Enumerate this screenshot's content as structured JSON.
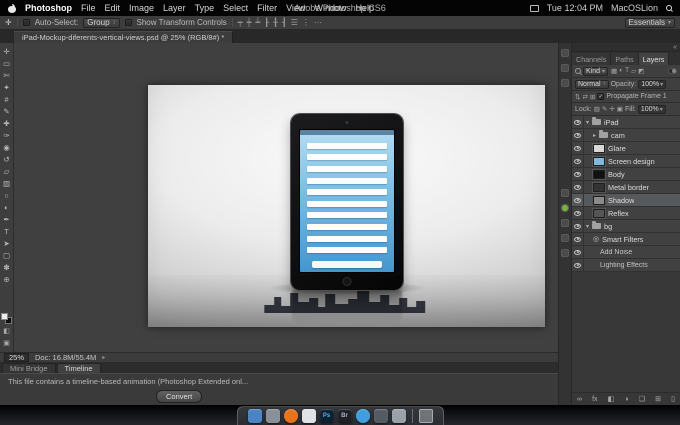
{
  "menubar": {
    "app_name": "Photoshop",
    "menus": [
      "File",
      "Edit",
      "Image",
      "Layer",
      "Type",
      "Select",
      "Filter",
      "View",
      "Window",
      "Help"
    ],
    "window_title": "Adobe Photoshop CS6",
    "time": "Tue 12:04 PM",
    "user": "MacOSLion"
  },
  "options_bar": {
    "tool_glyph": "✛",
    "auto_select_label": "Auto-Select:",
    "auto_select_value": "Group",
    "show_transform_label": "Show Transform Controls",
    "align_icons": [
      "┯",
      "┿",
      "┷",
      "┠",
      "╂",
      "┨",
      "☰",
      "⋮",
      "⋯"
    ],
    "workspace": "Essentials"
  },
  "ui_glyphs": {
    "popup": "↕",
    "dropdown": "▾",
    "collapse": "«",
    "status_arrow": "▸",
    "check": "✓"
  },
  "doc_tab": "iPad-Mockup-diferents-vertical-views.psd @ 25% (RGB/8#) *",
  "toolbar": {
    "tools": [
      {
        "name": "move-tool",
        "glyph": "✛"
      },
      {
        "name": "rectangular-marquee-tool",
        "glyph": "▭"
      },
      {
        "name": "lasso-tool",
        "glyph": "✄"
      },
      {
        "name": "quick-selection-tool",
        "glyph": "✦"
      },
      {
        "name": "crop-tool",
        "glyph": "#"
      },
      {
        "name": "eyedropper-tool",
        "glyph": "✎"
      },
      {
        "name": "healing-brush-tool",
        "glyph": "✚"
      },
      {
        "name": "brush-tool",
        "glyph": "✑"
      },
      {
        "name": "clone-stamp-tool",
        "glyph": "◉"
      },
      {
        "name": "history-brush-tool",
        "glyph": "↺"
      },
      {
        "name": "eraser-tool",
        "glyph": "▱"
      },
      {
        "name": "gradient-tool",
        "glyph": "▨"
      },
      {
        "name": "blur-tool",
        "glyph": "○"
      },
      {
        "name": "dodge-tool",
        "glyph": "◐"
      },
      {
        "name": "pen-tool",
        "glyph": "✒"
      },
      {
        "name": "type-tool",
        "glyph": "T"
      },
      {
        "name": "path-selection-tool",
        "glyph": "➤"
      },
      {
        "name": "shape-tool",
        "glyph": "▢"
      },
      {
        "name": "hand-tool",
        "glyph": "✽"
      },
      {
        "name": "zoom-tool",
        "glyph": "⊕"
      }
    ],
    "quick_mask_glyph": "◧",
    "screen_mode_glyph": "▣"
  },
  "panel_strip": {
    "icons": [
      {
        "name": "panel-icon-1",
        "color": "#4b4b4b"
      },
      {
        "name": "panel-icon-2",
        "color": "#4b4b4b"
      },
      {
        "name": "panel-icon-3",
        "color": "#4b4b4b"
      },
      {
        "name": "panel-icon-4",
        "color": "#4b4b4b",
        "gap_before": 95
      },
      {
        "name": "panel-icon-record",
        "color": "#77b43c",
        "shape": "circle"
      },
      {
        "name": "panel-icon-5",
        "color": "#4b4b4b"
      },
      {
        "name": "panel-icon-6",
        "color": "#4b4b4b"
      },
      {
        "name": "panel-icon-7",
        "color": "#4b4b4b"
      }
    ]
  },
  "layers_panel": {
    "tabs": [
      {
        "label": "Channels"
      },
      {
        "label": "Paths"
      },
      {
        "label": "Layers",
        "active": true
      }
    ],
    "filter": {
      "kind_label": "Kind",
      "type_icons": [
        {
          "name": "filter-pixel-layers-icon",
          "glyph": "▦"
        },
        {
          "name": "filter-adjustment-layers-icon",
          "glyph": "◐"
        },
        {
          "name": "filter-type-layers-icon",
          "glyph": "T"
        },
        {
          "name": "filter-shape-layers-icon",
          "glyph": "▱"
        },
        {
          "name": "filter-smart-objects-icon",
          "glyph": "◩"
        }
      ]
    },
    "blend": {
      "mode": "Normal",
      "opacity_label": "Opacity:",
      "opacity_value": "100%"
    },
    "unify": {
      "icons": [
        {
          "name": "unify-position-icon",
          "glyph": "⇅"
        },
        {
          "name": "unify-visibility-icon",
          "glyph": "⇄"
        },
        {
          "name": "unify-style-icon",
          "glyph": "⊞"
        }
      ],
      "propagate_label": "Propagate Frame 1"
    },
    "lock": {
      "label": "Lock:",
      "icons": [
        {
          "name": "lock-transparency-icon",
          "glyph": "▨"
        },
        {
          "name": "lock-image-icon",
          "glyph": "✎"
        },
        {
          "name": "lock-position-icon",
          "glyph": "✛"
        },
        {
          "name": "lock-all-icon",
          "glyph": "▣"
        }
      ],
      "fill_label": "Fill:",
      "fill_value": "100%"
    },
    "layers": [
      {
        "name": "iPad",
        "kind": "group",
        "depth": 0,
        "expanded": true
      },
      {
        "name": "cam",
        "kind": "group",
        "depth": 1
      },
      {
        "name": "Glare",
        "kind": "layer",
        "depth": 1,
        "thumb": "#d8d8d8"
      },
      {
        "name": "Screen design",
        "kind": "layer",
        "depth": 1,
        "thumb": "#7fb8dd"
      },
      {
        "name": "Body",
        "kind": "layer",
        "depth": 1,
        "thumb": "#111111"
      },
      {
        "name": "Metal border",
        "kind": "layer",
        "depth": 1,
        "thumb": "#333333"
      },
      {
        "name": "Shadow",
        "kind": "layer",
        "depth": 1,
        "thumb": "#8a8a8a",
        "selected": true
      },
      {
        "name": "Reflex",
        "kind": "layer",
        "depth": 1,
        "thumb": "#555555"
      },
      {
        "name": "bg",
        "kind": "group",
        "depth": 0,
        "expanded": true
      },
      {
        "name": "Smart Filters",
        "kind": "smart",
        "depth": 1,
        "glyph": "◎"
      },
      {
        "name": "Add Noise",
        "kind": "filter",
        "depth": 2
      },
      {
        "name": "Lighting Effects",
        "kind": "filter",
        "depth": 2
      }
    ],
    "footer_icons": [
      {
        "name": "link-layers-icon",
        "glyph": "∞"
      },
      {
        "name": "layer-style-icon",
        "glyph": "fx"
      },
      {
        "name": "add-mask-icon",
        "glyph": "◧"
      },
      {
        "name": "adjustment-icon",
        "glyph": "◑"
      },
      {
        "name": "new-group-icon",
        "glyph": "❏"
      },
      {
        "name": "new-layer-icon",
        "glyph": "⊞"
      },
      {
        "name": "delete-layer-icon",
        "glyph": "▯"
      }
    ]
  },
  "status_bar": {
    "zoom": "25%",
    "doc_info": "Doc: 16.8M/55.4M"
  },
  "bottom_tabs": [
    {
      "label": "Mini Bridge"
    },
    {
      "label": "Timeline",
      "active": true
    }
  ],
  "timeline": {
    "warning": "This file contains a timeline-based animation (Photoshop Extended onl...",
    "convert_label": "Convert"
  },
  "dock": {
    "icons": [
      {
        "name": "dock-finder",
        "color": "#4a84c4",
        "shape": "square"
      },
      {
        "name": "dock-dashboard",
        "color": "#8a9099",
        "shape": "square"
      },
      {
        "name": "dock-firefox",
        "color": "#e8731a",
        "shape": "circle"
      },
      {
        "name": "dock-preview",
        "color": "#dfe2e6",
        "shape": "square"
      },
      {
        "name": "dock-photoshop",
        "color": "#10202e",
        "shape": "square",
        "label": "Ps",
        "label_color": "#31c5f0"
      },
      {
        "name": "dock-bridge",
        "color": "#1e2026",
        "shape": "square",
        "label": "Br",
        "label_color": "#aab4d4"
      },
      {
        "name": "dock-appstore",
        "color": "#3f9ede",
        "shape": "circle"
      },
      {
        "name": "dock-utility",
        "color": "#555b63",
        "shape": "square"
      },
      {
        "name": "dock-system-preferences",
        "color": "#9aa1a9",
        "shape": "square"
      },
      {
        "name": "dock-trash",
        "color": "rgba(190,195,200,0.45)",
        "shape": "trash",
        "separator_before": true
      }
    ]
  },
  "mockup": {
    "screen_rows": 10
  }
}
